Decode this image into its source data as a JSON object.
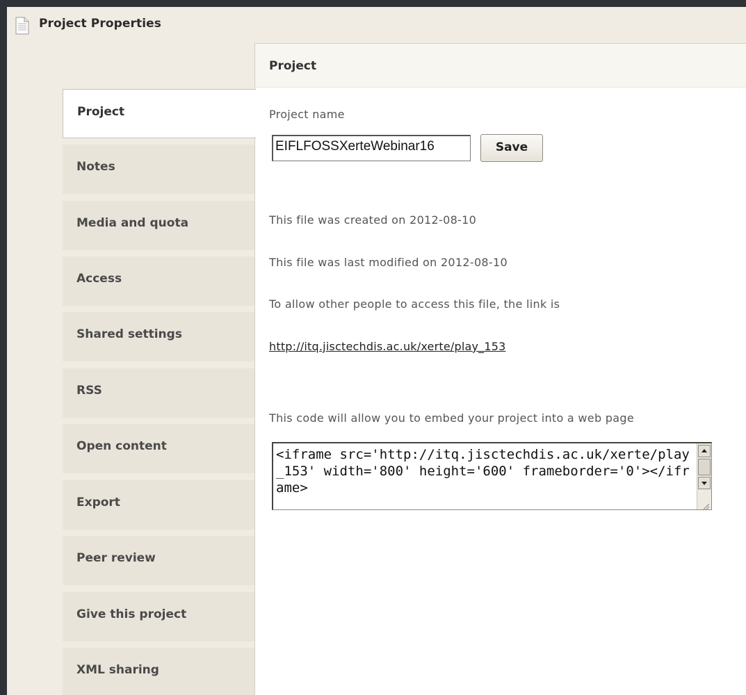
{
  "window": {
    "title": "Project Properties",
    "title_icon": "document-icon"
  },
  "tabs": [
    {
      "label": "Project",
      "active": true
    },
    {
      "label": "Notes",
      "active": false
    },
    {
      "label": "Media and quota",
      "active": false
    },
    {
      "label": "Access",
      "active": false
    },
    {
      "label": "Shared settings",
      "active": false
    },
    {
      "label": "RSS",
      "active": false
    },
    {
      "label": "Open content",
      "active": false
    },
    {
      "label": "Export",
      "active": false
    },
    {
      "label": "Peer review",
      "active": false
    },
    {
      "label": "Give this project",
      "active": false
    },
    {
      "label": "XML sharing",
      "active": false
    }
  ],
  "panel": {
    "header": "Project",
    "project_name_label": "Project name",
    "project_name_value": "EIFLFOSSXerteWebinar16",
    "save_label": "Save",
    "created_text": "This file was created on 2012-08-10",
    "modified_text": "This file was last modified on 2012-08-10",
    "access_text": "To allow other people to access this file, the link is",
    "link": "http://itq.jisctechdis.ac.uk/xerte/play_153",
    "embed_text": "This code will allow you to embed your project into a web page",
    "embed_code": "<iframe src='http://itq.jisctechdis.ac.uk/xerte/play_153' width='800' height='600' frameborder='0'></iframe>"
  },
  "colors": {
    "background_dark": "#2e3338",
    "window_bg": "#f1ece3",
    "tab_bg": "#e9e4da",
    "panel_bg": "#ffffff"
  }
}
